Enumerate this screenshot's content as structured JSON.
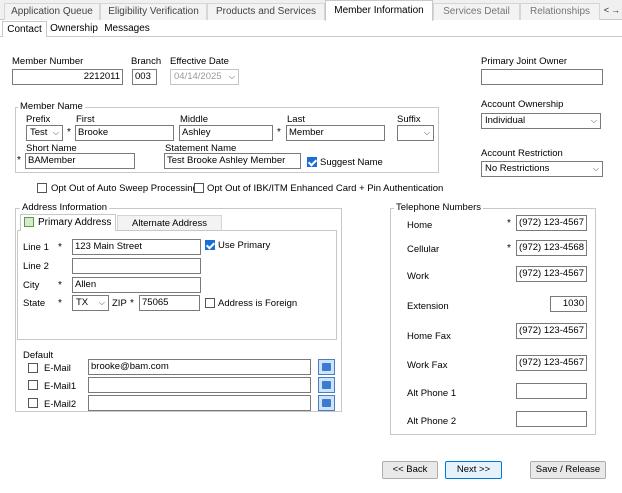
{
  "top_tabs": [
    {
      "label": "Application Queue",
      "state": "normal"
    },
    {
      "label": "Eligibility Verification",
      "state": "normal"
    },
    {
      "label": "Products and Services",
      "state": "normal"
    },
    {
      "label": "Member Information",
      "state": "active"
    },
    {
      "label": "Services Detail",
      "state": "dim"
    },
    {
      "label": "Relationships",
      "state": "dim"
    }
  ],
  "sub_tabs": [
    {
      "label": "Contact"
    },
    {
      "label": "Ownership"
    },
    {
      "label": "Messages"
    }
  ],
  "member_number": {
    "label": "Member Number",
    "value": "2212011"
  },
  "branch": {
    "label": "Branch",
    "value": "003"
  },
  "effective_date": {
    "label": "Effective Date",
    "value": "04/14/2025"
  },
  "member_name": {
    "group_label": "Member Name",
    "prefix": {
      "label": "Prefix",
      "value": "Test"
    },
    "first": {
      "label": "First",
      "value": "Brooke"
    },
    "middle": {
      "label": "Middle",
      "value": "Ashley"
    },
    "last": {
      "label": "Last",
      "value": "Member"
    },
    "suffix": {
      "label": "Suffix",
      "value": ""
    },
    "short_name": {
      "label": "Short Name",
      "value": "BAMember"
    },
    "statement_name": {
      "label": "Statement Name",
      "value": "Test Brooke Ashley Member"
    },
    "suggest_name": {
      "label": "Suggest Name",
      "checked": true
    }
  },
  "primary_joint_owner": {
    "label": "Primary Joint Owner",
    "value": ""
  },
  "account_ownership": {
    "label": "Account Ownership",
    "value": "Individual"
  },
  "account_restriction": {
    "label": "Account Restriction",
    "value": "No Restrictions"
  },
  "opt_out_sweep": {
    "label": "Opt Out of Auto Sweep Processing",
    "checked": false
  },
  "opt_out_ibk": {
    "label": "Opt Out of IBK/ITM Enhanced Card + Pin Authentication",
    "checked": false
  },
  "address": {
    "group_label": "Address Information",
    "tabs": [
      {
        "label": "Primary Address"
      },
      {
        "label": "Alternate Address"
      }
    ],
    "line1": {
      "label": "Line 1",
      "value": "123 Main Street"
    },
    "use_primary": {
      "label": "Use Primary",
      "checked": true
    },
    "line2": {
      "label": "Line 2",
      "value": ""
    },
    "city": {
      "label": "City",
      "value": "Allen"
    },
    "state": {
      "label": "State",
      "value": "TX"
    },
    "zip": {
      "label": "ZIP",
      "value": "75065"
    },
    "foreign": {
      "label": "Address is Foreign",
      "checked": false
    },
    "default_label": "Default",
    "emails": [
      {
        "label": "E-Mail",
        "value": "brooke@bam.com",
        "checked": false
      },
      {
        "label": "E-Mail1",
        "value": "",
        "checked": false
      },
      {
        "label": "E-Mail2",
        "value": "",
        "checked": false
      }
    ]
  },
  "phones": {
    "group_label": "Telephone Numbers",
    "items": [
      {
        "label": "Home",
        "value": "(972) 123-4567",
        "required": true
      },
      {
        "label": "Cellular",
        "value": "(972) 123-4568",
        "required": true
      },
      {
        "label": "Work",
        "value": "(972) 123-4567",
        "required": false
      },
      {
        "label": "Extension",
        "value": "1030",
        "required": false
      },
      {
        "label": "Home Fax",
        "value": "(972) 123-4567",
        "required": false
      },
      {
        "label": "Work Fax",
        "value": "(972) 123-4567",
        "required": false
      },
      {
        "label": "Alt Phone 1",
        "value": "",
        "required": false
      },
      {
        "label": "Alt Phone 2",
        "value": "",
        "required": false
      }
    ]
  },
  "required_marker": "*",
  "buttons": {
    "back": "<< Back",
    "next": "Next >>",
    "save": "Save / Release"
  },
  "nav_arrows": {
    "left": "<",
    "right": "→"
  }
}
